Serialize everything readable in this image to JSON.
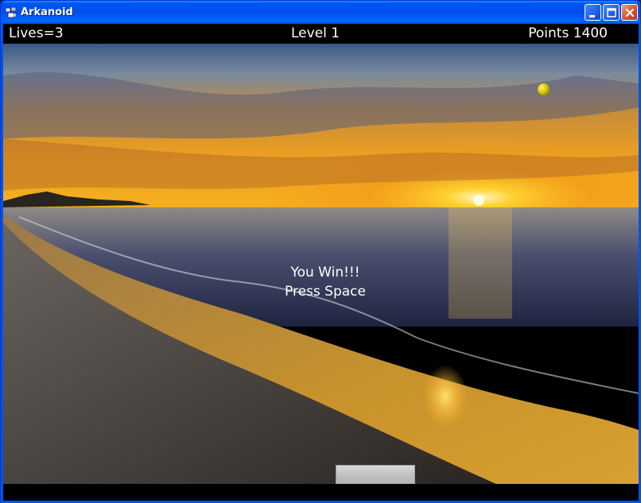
{
  "window": {
    "title": "Arkanoid",
    "icon": "arkanoid-app-icon"
  },
  "controls": {
    "minimize": "minimize-icon",
    "maximize": "maximize-icon",
    "close": "close-icon"
  },
  "hud": {
    "lives": "Lives=3",
    "level": "Level 1",
    "points": "Points 1400"
  },
  "message": {
    "line1": "You Win!!!",
    "line2": "Press Space"
  },
  "colors": {
    "titlebar": "#0054e3",
    "hud_bg": "#000000",
    "ball": "#d8c800",
    "paddle": "#c4c4c4"
  }
}
